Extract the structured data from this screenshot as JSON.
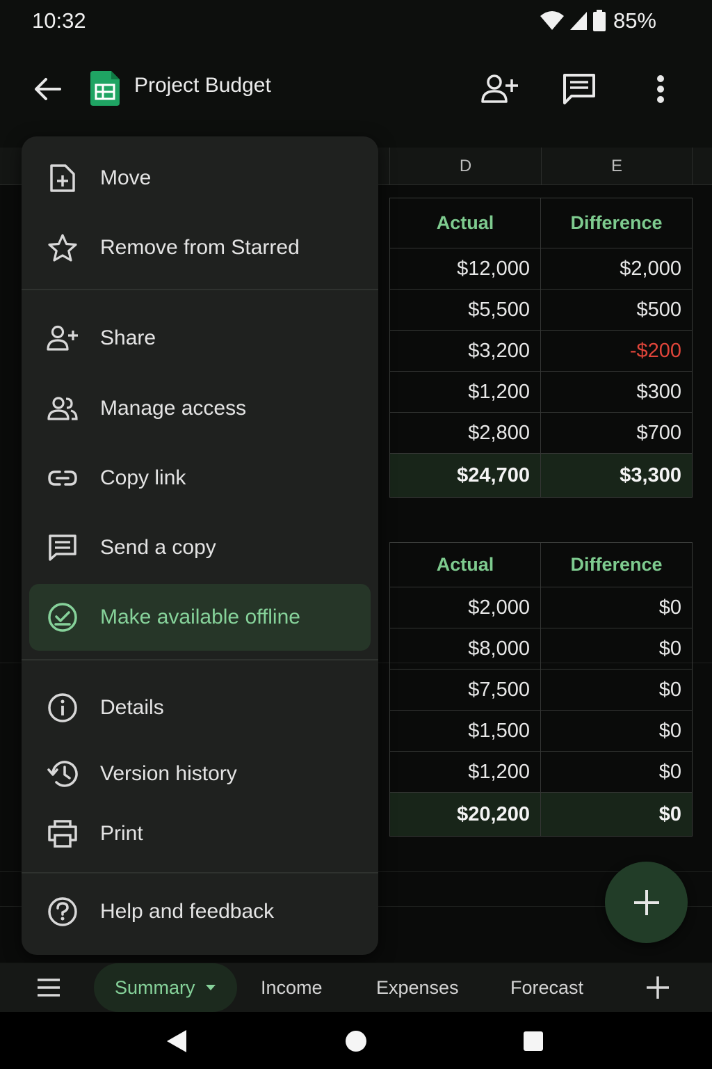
{
  "status_bar": {
    "time": "10:32",
    "battery": "85%"
  },
  "app_bar": {
    "title": "Project Budget"
  },
  "sheet": {
    "column_headers": [
      "D",
      "E"
    ],
    "table1": {
      "headers": [
        "Actual",
        "Difference"
      ],
      "rows": [
        [
          "$12,000",
          "$2,000"
        ],
        [
          "$5,500",
          "$500"
        ],
        [
          "$3,200",
          "-$200"
        ],
        [
          "$1,200",
          "$300"
        ],
        [
          "$2,800",
          "$700"
        ]
      ],
      "total": [
        "$24,700",
        "$3,300"
      ]
    },
    "table2": {
      "headers": [
        "Actual",
        "Difference"
      ],
      "rows": [
        [
          "$2,000",
          "$0"
        ],
        [
          "$8,000",
          "$0"
        ],
        [
          "$7,500",
          "$0"
        ],
        [
          "$1,500",
          "$0"
        ],
        [
          "$1,200",
          "$0"
        ]
      ],
      "total": [
        "$20,200",
        "$0"
      ]
    }
  },
  "menu": {
    "items": [
      {
        "label": "Move",
        "icon": "move-icon"
      },
      {
        "label": "Remove from Starred",
        "icon": "star-icon"
      },
      {
        "label": "Share",
        "icon": "add-person-icon"
      },
      {
        "label": "Manage access",
        "icon": "people-icon"
      },
      {
        "label": "Copy link",
        "icon": "link-icon"
      },
      {
        "label": "Send a copy",
        "icon": "message-icon"
      },
      {
        "label": "Make available offline",
        "icon": "offline-check-icon"
      },
      {
        "label": "Details",
        "icon": "info-icon"
      },
      {
        "label": "Version history",
        "icon": "history-icon"
      },
      {
        "label": "Print",
        "icon": "print-icon"
      },
      {
        "label": "Help and feedback",
        "icon": "help-icon"
      }
    ]
  },
  "tabs": {
    "items": [
      "Summary",
      "Income",
      "Expenses",
      "Forecast"
    ],
    "active": "Summary"
  },
  "colors": {
    "accent": "#86d29a",
    "active_bg": "#263628",
    "negative": "#e0453a",
    "fab": "#223d28",
    "sheets_green": "#1fa463"
  }
}
